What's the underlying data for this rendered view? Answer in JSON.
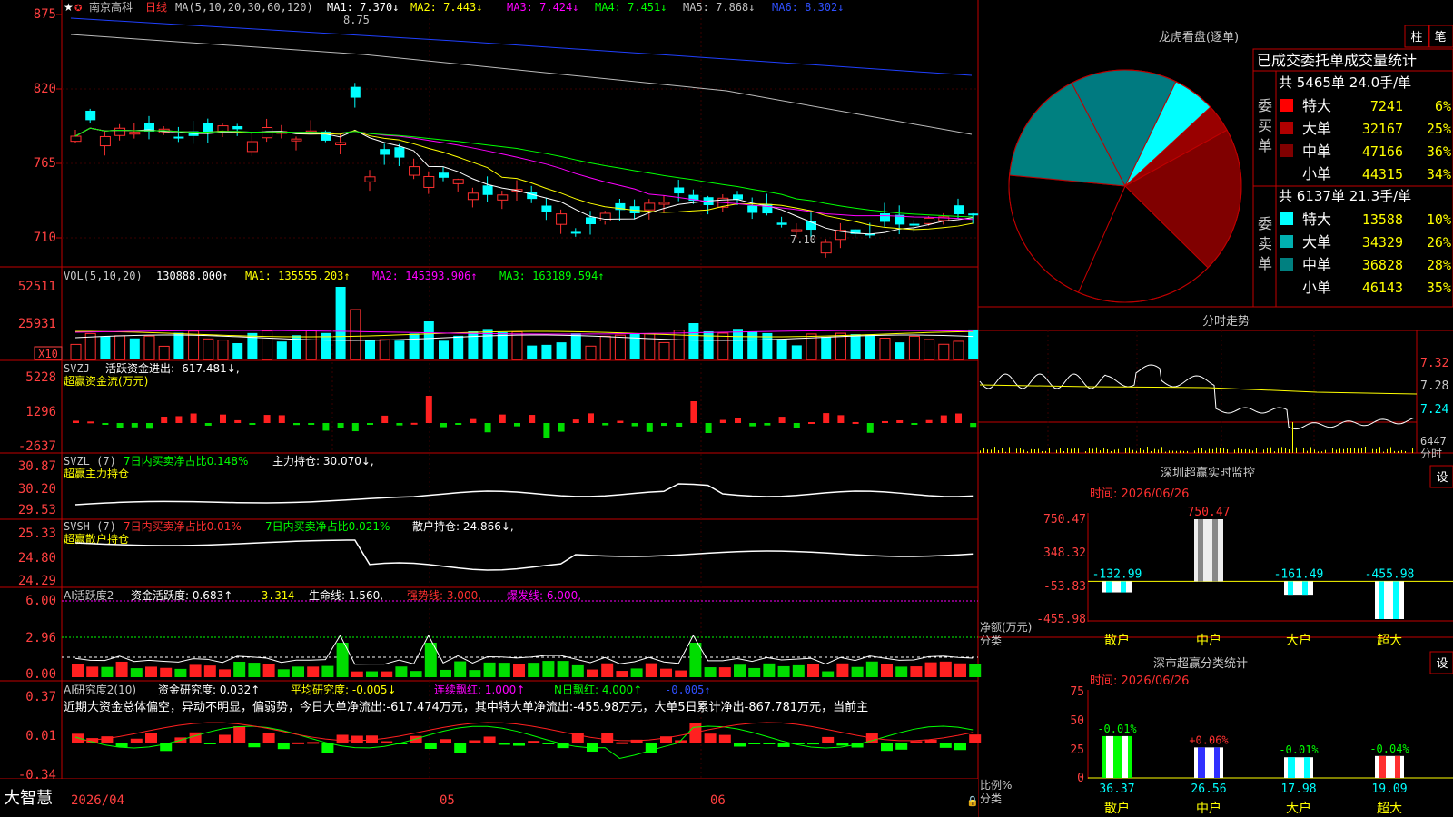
{
  "header": {
    "stock_name": "南京高科",
    "period": "日线",
    "ma_label": "MA(5,10,20,30,60,120)",
    "ma1": "MA1: 7.370↓",
    "ma2": "MA2: 7.443↓",
    "ma3": "MA3: 7.424↓",
    "ma4": "MA4: 7.451↓",
    "ma5": "MA5: 7.868↓",
    "ma6": "MA6: 8.302↓"
  },
  "price_axis": [
    "875",
    "820",
    "765",
    "710"
  ],
  "price_marks": {
    "high": "8.75",
    "low": "7.10"
  },
  "vol": {
    "axis": [
      "52511",
      "25931",
      "X10"
    ],
    "label": "VOL(5,10,20)",
    "value": "130888.000↑",
    "ma1": "MA1: 135555.203↑",
    "ma2": "MA2: 145393.906↑",
    "ma3": "MA3: 163189.594↑"
  },
  "svzj": {
    "axis": [
      "5228",
      "1296",
      "-2637"
    ],
    "label": "SVZJ",
    "text": "活跃资金进出: -617.481↓,",
    "subtitle": "超赢资金流(万元)"
  },
  "svzl": {
    "axis": [
      "30.87",
      "30.20",
      "29.53"
    ],
    "label": "SVZL (7)",
    "text1": "7日内买卖净占比0.148%",
    "text2": "主力持仓: 30.070↓,",
    "subtitle": "超赢主力持仓"
  },
  "svsh": {
    "axis": [
      "25.33",
      "24.80",
      "24.29"
    ],
    "label": "SVSH (7)",
    "text1": "7日内买卖净占比0.01%",
    "text2": "7日内买卖净占比0.021%",
    "text3": "散户持仓: 24.866↓,",
    "subtitle": "超赢散户持仓"
  },
  "ai_active": {
    "axis": [
      "6.00",
      "2.96",
      "0.00"
    ],
    "label": "AI活跃度2",
    "text1": "资金活跃度: 0.683↑",
    "text2": "3.314",
    "text3": "生命线: 1.560,",
    "text4": "强势线: 3.000,",
    "text5": "爆发线: 6.000,"
  },
  "ai_research": {
    "axis": [
      "0.37",
      "0.01",
      "-0.34"
    ],
    "label": "AI研究度2(10)",
    "text1": "资金研究度: 0.032↑",
    "text2": "平均研究度: -0.005↓",
    "text3": "连续飘红: 1.000↑",
    "text4": "N日飘红: 4.000↑",
    "text5": "-0.005↑",
    "comment": "近期大资金总体偏空，异动不明显，偏弱势，今日大单净流出:-617.474万元，其中特大单净流出:-455.98万元，大单5日累计净出-867.781万元，当前主"
  },
  "bottom": {
    "brand": "大智慧",
    "date1": "2026/04",
    "date2": "05",
    "date3": "06"
  },
  "dragon": {
    "title": "龙虎看盘(逐单)",
    "btn1": "柱",
    "btn2": "笔",
    "table_title": "已成交委托单成交量统计",
    "buy_summary": "共 5465单 24.0手/单",
    "sell_summary": "共 6137单 21.3手/单",
    "buy_label": "委买单",
    "sell_label": "委卖单",
    "buy_rows": [
      {
        "name": "特大",
        "value": "7241",
        "pct": "6%"
      },
      {
        "name": "大单",
        "value": "32167",
        "pct": "25%"
      },
      {
        "name": "中单",
        "value": "47166",
        "pct": "36%"
      },
      {
        "name": "小单",
        "value": "44315",
        "pct": "34%"
      }
    ],
    "sell_rows": [
      {
        "name": "特大",
        "value": "13588",
        "pct": "10%"
      },
      {
        "name": "大单",
        "value": "34329",
        "pct": "26%"
      },
      {
        "name": "中单",
        "value": "36828",
        "pct": "28%"
      },
      {
        "name": "小单",
        "value": "46143",
        "pct": "35%"
      }
    ],
    "buy_colors": [
      "#ff0000",
      "#b00000",
      "#800000",
      "#000000"
    ],
    "sell_colors": [
      "#00ffff",
      "#00b0b0",
      "#008080",
      "#000000"
    ]
  },
  "pie": {
    "slices": [
      {
        "label": "买特大",
        "pct": 3.1,
        "color": "#ff0000"
      },
      {
        "label": "买大单",
        "pct": 13.9,
        "color": "#990000"
      },
      {
        "label": "买中单",
        "pct": 20.4,
        "color": "#800000"
      },
      {
        "label": "买小单",
        "pct": 19.2,
        "color": "#000000"
      },
      {
        "label": "卖小单",
        "pct": 19.9,
        "color": "#000000"
      },
      {
        "label": "卖中单",
        "pct": 15.9,
        "color": "#008080"
      },
      {
        "label": "卖大单",
        "pct": 14.8,
        "color": "#007a80"
      },
      {
        "label": "卖特大",
        "pct": 5.9,
        "color": "#00ffff"
      }
    ]
  },
  "intraday": {
    "title": "分时走势",
    "axis": [
      "7.32",
      "7.28",
      "7.24"
    ],
    "vol_value": "6447",
    "vol_label": "分时"
  },
  "szrt": {
    "title": "深圳超赢实时监控",
    "settings": "设",
    "time": "时间: 2026/06/26",
    "axis": [
      "750.47",
      "348.32",
      "-53.83",
      "-455.98"
    ],
    "side1": "净额(万元)",
    "side2": "分类",
    "categories": [
      "散户",
      "中户",
      "大户",
      "超大"
    ],
    "values": [
      -132.99,
      750.47,
      -161.49,
      -455.98
    ],
    "value_labels": [
      "-132.99",
      "750.47",
      "-161.49",
      "-455.98"
    ]
  },
  "szcls": {
    "title": "深市超赢分类统计",
    "settings": "设",
    "time": "时间: 2026/06/26",
    "axis": [
      "75",
      "50",
      "25",
      "0"
    ],
    "side1": "比例%",
    "side2": "分类",
    "categories": [
      "散户",
      "中户",
      "大户",
      "超大"
    ],
    "values": [
      36.37,
      26.56,
      17.98,
      19.09
    ],
    "value_labels": [
      "36.37",
      "26.56",
      "17.98",
      "19.09"
    ],
    "changes": [
      "-0.01%",
      "+0.06%",
      "-0.01%",
      "-0.04%"
    ]
  },
  "chart_data": [
    {
      "type": "bar",
      "title": "深圳超赢实时监控",
      "ylabel": "净额(万元)",
      "categories": [
        "散户",
        "中户",
        "大户",
        "超大"
      ],
      "values": [
        -132.99,
        750.47,
        -161.49,
        -455.98
      ],
      "ylim": [
        -455.98,
        750.47
      ]
    },
    {
      "type": "bar",
      "title": "深市超赢分类统计",
      "ylabel": "比例%",
      "categories": [
        "散户",
        "中户",
        "大户",
        "超大"
      ],
      "values": [
        36.37,
        26.56,
        17.98,
        19.09
      ],
      "ylim": [
        0,
        75
      ]
    },
    {
      "type": "pie",
      "title": "龙虎看盘(逐单)",
      "categories": [
        "买特大",
        "买大单",
        "买中单",
        "买小单",
        "卖小单",
        "卖中单",
        "卖大单",
        "卖特大"
      ],
      "values": [
        7241,
        32167,
        47166,
        44315,
        46143,
        36828,
        34329,
        13588
      ]
    }
  ]
}
